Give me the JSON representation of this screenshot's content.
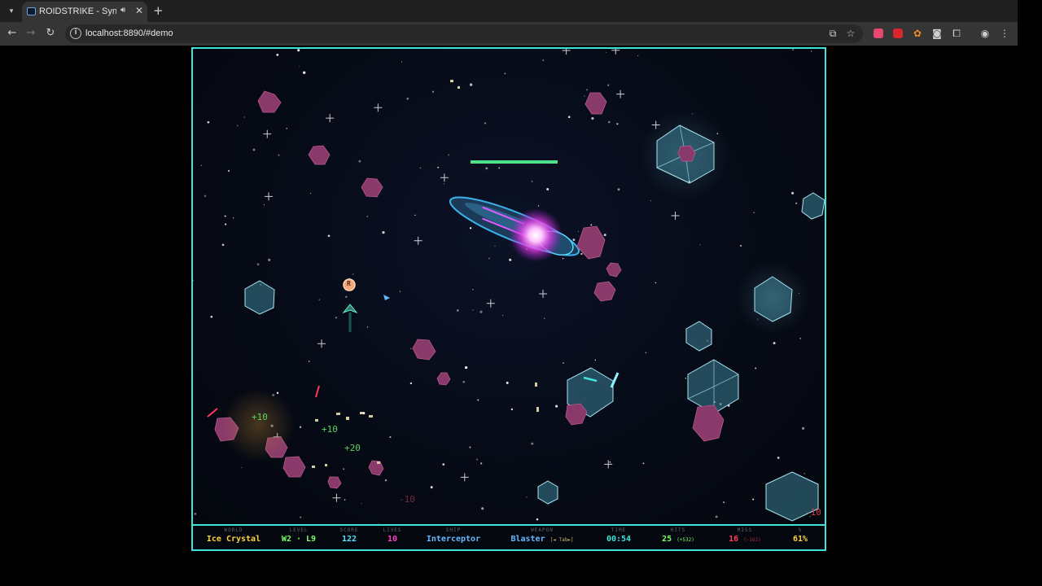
{
  "browser": {
    "tab_title": "ROIDSTRIKE - Synthw",
    "url": "localhost:8890/#demo"
  },
  "game": {
    "floaters": [
      {
        "text": "+10",
        "color": "#5ad45a"
      },
      {
        "text": "+10",
        "color": "#5ad45a"
      },
      {
        "text": "+20",
        "color": "#5ad45a"
      },
      {
        "text": "-10",
        "color": "#7a2b3a"
      },
      {
        "text": "-10",
        "color": "#d33a4a"
      }
    ],
    "powerup_label": "R",
    "boss_health_fraction": 1.0
  },
  "hud": {
    "world": {
      "label": "WORLD",
      "value": "Ice Crystal",
      "color": "#ffd23f"
    },
    "level": {
      "label": "LEVEL",
      "value": "W2 · L9",
      "color": "#7dff6a"
    },
    "score": {
      "label": "SCORE",
      "value": "122",
      "color": "#56e6ff"
    },
    "lives": {
      "label": "LIVES",
      "value": "10",
      "color": "#ff3ec8"
    },
    "ship": {
      "label": "SHIP",
      "value": "Interceptor",
      "color": "#66b8ff"
    },
    "weapon": {
      "label": "WEAPON",
      "value": "Blaster",
      "hint": "[◄ Tab►]",
      "color": "#66b8ff"
    },
    "time": {
      "label": "TIME",
      "value": "00:54",
      "color": "#3fe3d8"
    },
    "hits": {
      "label": "HITS",
      "value": "25",
      "sub": "(+532)",
      "color": "#7dff6a"
    },
    "miss": {
      "label": "MISS",
      "value": "16",
      "sub": "(-162)",
      "color": "#ff3b5c"
    },
    "accuracy": {
      "label": "%",
      "value": "61%",
      "color": "#ffd23f"
    }
  }
}
